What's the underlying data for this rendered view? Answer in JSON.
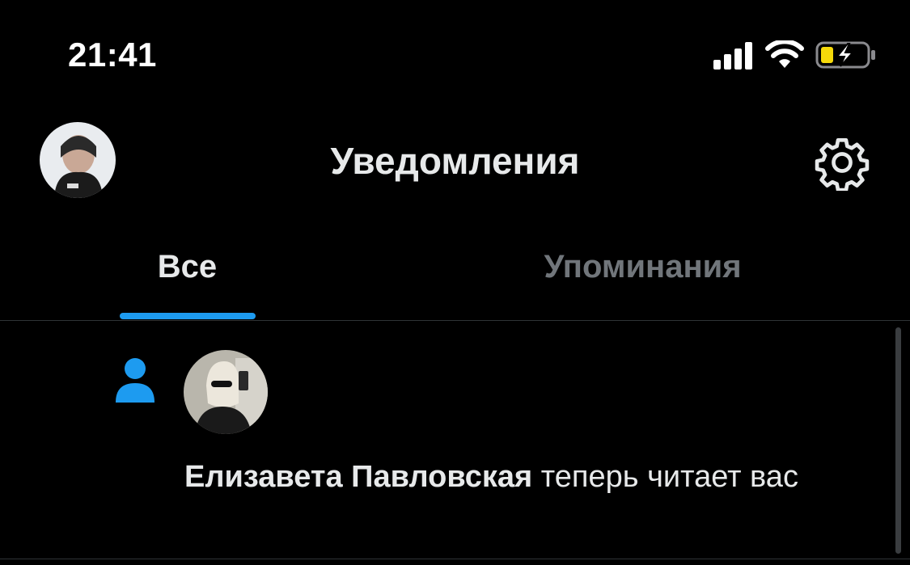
{
  "status_bar": {
    "time": "21:41",
    "icons": [
      "cellular-signal-icon",
      "wifi-icon",
      "battery-charging-icon"
    ]
  },
  "header": {
    "title": "Уведомления",
    "avatar_icon": "profile-avatar",
    "settings_icon": "gear-icon"
  },
  "tabs": [
    {
      "label": "Все",
      "active": true
    },
    {
      "label": "Упоминания",
      "active": false
    }
  ],
  "notifications": [
    {
      "type_icon": "person-follow-icon",
      "user_name": "Елизавета Павловская",
      "action_text": "теперь читает вас"
    }
  ],
  "colors": {
    "background": "#000000",
    "text_primary": "#e7e9ea",
    "text_secondary": "#71767b",
    "accent": "#1d9bf0",
    "battery_charge": "#f5d90a"
  }
}
